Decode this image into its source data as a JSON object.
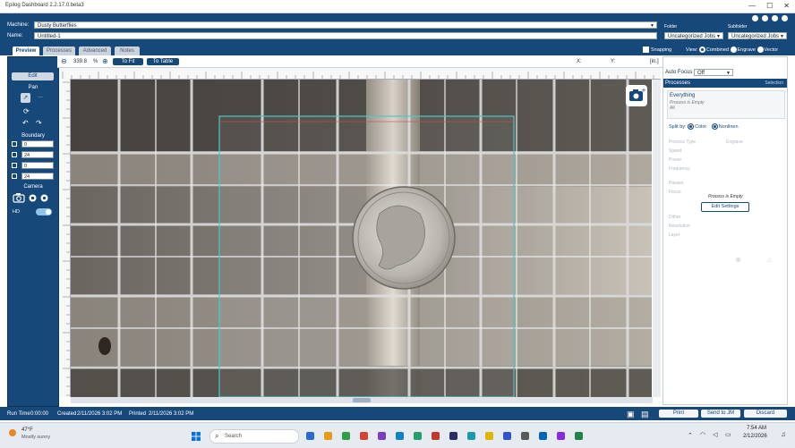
{
  "window": {
    "title": "Epilog Dashboard 2.2.17.0.beta3",
    "controls": {
      "minimize": "—",
      "maximize": "☐",
      "close": "✕"
    }
  },
  "header": {
    "machine_label": "Machine:",
    "machine_value": "Dusty Butterflies",
    "name_label": "Name:",
    "name_value": "Untitled-1",
    "folder_label": "Folder",
    "folder_value": "Uncategorized Jobs",
    "subfolder_label": "Subfolder",
    "subfolder_value": "Uncategorized Jobs"
  },
  "tabs": [
    {
      "label": "Preview"
    },
    {
      "label": "Processes"
    },
    {
      "label": "Advanced"
    },
    {
      "label": "Notes"
    }
  ],
  "top_options": {
    "snapping": "Snapping",
    "view_label": "View:",
    "view_options": [
      "Combined",
      "Engrave",
      "Vector"
    ],
    "view_selected": "Combined"
  },
  "left_panel": {
    "edit_label": "Edit",
    "pan_label": "Pan",
    "pan_dots": "···",
    "boundary_label": "Boundary",
    "boundary_values": [
      "0",
      "24",
      "0",
      "24"
    ],
    "camera_label": "Camera",
    "hd_label": "HD"
  },
  "toolbar": {
    "zoom_value": "339.8",
    "zoom_unit": "%",
    "to_fit": "To Fit",
    "to_table": "To Table",
    "x_label": "X:",
    "y_label": "Y:",
    "unit": "[in.]"
  },
  "right_panel": {
    "auto_focus_label": "Auto Focus",
    "auto_focus_value": "Off",
    "processes_header": "Processes",
    "selection_label": "Selection",
    "everything_title": "Everything",
    "everything_sub1": "Process is Empty",
    "everything_sub2": "All",
    "split_by_label": "Split by:",
    "split_options": [
      "Color",
      "Nonlinen"
    ],
    "process_empty": "Process is Empty",
    "edit_settings": "Edit Settings",
    "faded_rows": [
      "Process Type",
      "Engrave",
      "Speed",
      "Power",
      "Frequency",
      "Passes",
      "Focus",
      "Dither",
      "Resolution",
      "Layer"
    ]
  },
  "status": {
    "run_time_label": "Run Time",
    "run_time": "0:00:00",
    "created_label": "Created",
    "created": "2/11/2026 3:02 PM",
    "printed_label": "Printed",
    "printed": "2/11/2026 3:02 PM",
    "print_btn": "Print",
    "send_btn": "Send to JM",
    "discard_btn": "Discard"
  },
  "taskbar": {
    "weather_temp": "47°F",
    "weather_desc": "Mostly sunny",
    "search_placeholder": "Search",
    "time": "7:54 AM",
    "date": "2/12/2026",
    "app_icon_colors": [
      "#2a6bd3",
      "#e89a12",
      "#2ea043",
      "#d2452e",
      "#7a3fc0",
      "#0a84c6",
      "#22a06b",
      "#c0392b",
      "#2b2b6a",
      "#1b9aaa",
      "#e0b400",
      "#3355cc",
      "#5a5a5a",
      "#0067b8",
      "#8a2be2",
      "#1e8449"
    ]
  },
  "colors": {
    "brand_blue": "#17487a",
    "cyan_box": "#4dc7c7",
    "red_guide": "#d24c4c"
  }
}
